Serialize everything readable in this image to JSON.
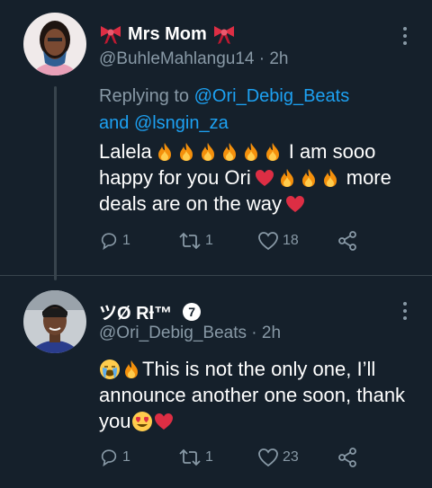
{
  "tweets": [
    {
      "display_name": "Mrs Mom",
      "handle": "@BuhleMahlangu14",
      "time": "2h",
      "replying_prefix": "Replying to",
      "replying_to_1": "@Ori_Debig_Beats",
      "replying_and": "and",
      "replying_to_2": "@lsngin_za",
      "text_1": "Lalela",
      "text_2": "I am sooo",
      "text_3": "happy for you Ori",
      "text_4": "more",
      "text_5": "deals are on the way",
      "replies": "1",
      "retweets": "1",
      "likes": "18"
    },
    {
      "display_name": "ツØ Rƚ™",
      "badge": "7",
      "handle": "@Ori_Debig_Beats",
      "time": "2h",
      "text_1": "This is not the only one, I’ll",
      "text_2": "announce another one soon, thank",
      "text_3": "you",
      "replies": "1",
      "retweets": "1",
      "likes": "23"
    }
  ],
  "separator": "·",
  "icons": {
    "reply": "reply-icon",
    "retweet": "retweet-icon",
    "like": "heart-icon",
    "share": "share-icon",
    "more": "more-options-icon",
    "bow": "ribbon-bow-emoji",
    "fire": "fire-emoji",
    "heart_red": "red-heart-emoji",
    "crying": "crying-face-emoji",
    "heart_eyes": "heart-eyes-emoji"
  },
  "colors": {
    "background": "#15202b",
    "secondary_text": "#8899a6",
    "link": "#1da1f2",
    "heart": "#e0245e"
  }
}
